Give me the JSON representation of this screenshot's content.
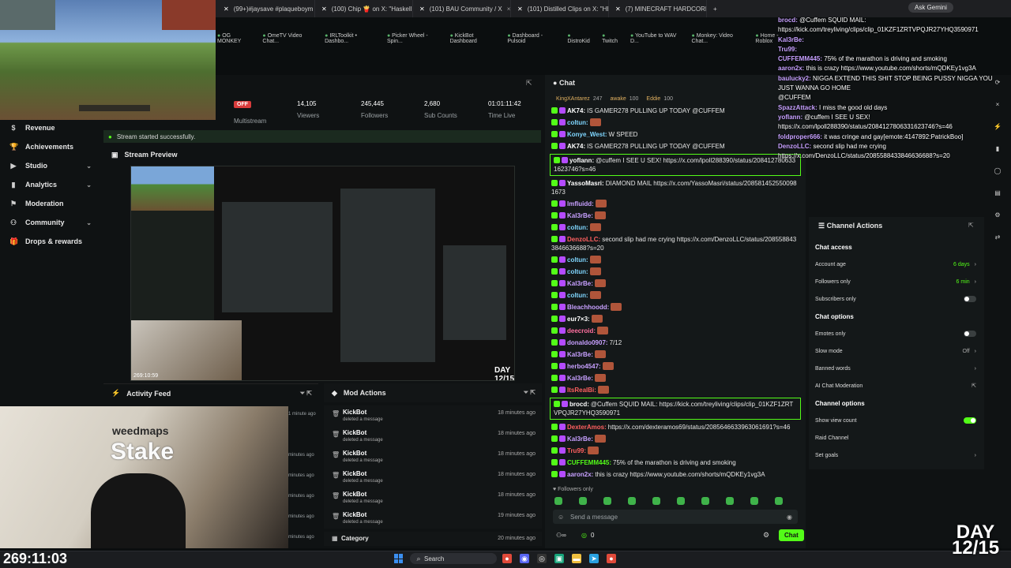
{
  "browser": {
    "tabs": [
      {
        "label": "(99+)#jaysave #plaqueboym"
      },
      {
        "label": "(100) Chip 🍟 on X: \"Haskell, C"
      },
      {
        "label": "(101) BAU Community / X"
      },
      {
        "label": "(101) Distilled Clips on X: \"HE T"
      },
      {
        "label": "(7) MINECRAFT HARDCORE AL"
      }
    ],
    "ask_gemini": "Ask Gemini",
    "bookmarks": [
      "OG MONKEY",
      "OmeTV Video Chat...",
      "IRLToolkit • Dashbo...",
      "Picker Wheel - Spin...",
      "KickBot Dashboard",
      "Dashboard - Pulsoid",
      "DistroKid",
      "Twitch",
      "YouTube to WAV D...",
      "Monkey: Video Chat...",
      "Home - Roblox"
    ]
  },
  "stats": {
    "offline_badge": "OFF",
    "multistream_label": "Multistream",
    "viewers_value": "14,105",
    "viewers_label": "Viewers",
    "followers_value": "245,445",
    "followers_label": "Followers",
    "subs_value": "2,680",
    "subs_label": "Sub Counts",
    "time_value": "01:01:11:42",
    "time_label": "Time Live"
  },
  "toast": "Stream started successfully.",
  "sidebar": {
    "items": [
      {
        "label": "Revenue",
        "chevron": false
      },
      {
        "label": "Achievements",
        "chevron": false
      },
      {
        "label": "Studio",
        "chevron": true
      },
      {
        "label": "Analytics",
        "chevron": true
      },
      {
        "label": "Moderation",
        "chevron": false
      },
      {
        "label": "Community",
        "chevron": true
      },
      {
        "label": "Drops & rewards",
        "chevron": false
      }
    ]
  },
  "stream_preview": {
    "title": "Stream Preview",
    "day_label": "DAY 12/15",
    "timer": "269:10:59"
  },
  "activity_feed": {
    "title": "Activity Feed",
    "times": [
      "1 minute ago",
      "",
      "minutes ago",
      "minutes ago",
      "minutes ago",
      "minutes ago",
      "minutes ago"
    ]
  },
  "mod_actions": {
    "title": "Mod Actions",
    "rows": [
      {
        "name": "KickBot",
        "desc": "deleted a message",
        "time": "18 minutes ago"
      },
      {
        "name": "KickBot",
        "desc": "deleted a message",
        "time": "18 minutes ago"
      },
      {
        "name": "KickBot",
        "desc": "deleted a message",
        "time": "18 minutes ago"
      },
      {
        "name": "KickBot",
        "desc": "deleted a message",
        "time": "18 minutes ago"
      },
      {
        "name": "KickBot",
        "desc": "deleted a message",
        "time": "18 minutes ago"
      },
      {
        "name": "KickBot",
        "desc": "deleted a message",
        "time": "19 minutes ago"
      }
    ],
    "footer_label": "Category",
    "footer_time": "20 minutes ago"
  },
  "chat": {
    "title": "Chat",
    "pinned": [
      {
        "user": "KingXAntarez",
        "value": "247"
      },
      {
        "user": "awake",
        "value": "100"
      },
      {
        "user": "Eddie",
        "value": "100"
      }
    ],
    "messages": [
      {
        "user": "AK74:",
        "text": "IS GAMER278 PULLING UP TODAY @CUFFEM",
        "color": "#ffffff",
        "hl": false
      },
      {
        "user": "coltun:",
        "text": "",
        "color": "#7fd6ff",
        "hl": false
      },
      {
        "user": "Konye_West:",
        "text": "W SPEED",
        "color": "#7fd6ff",
        "hl": false
      },
      {
        "user": "AK74:",
        "text": "IS GAMER278 PULLING UP TODAY @CUFFEM",
        "color": "#ffffff",
        "hl": false
      },
      {
        "user": "yoflann:",
        "text": "@cuffem I SEE U SEX! https://x.com/lpoll288390/status/2084127806331623746?s=46",
        "color": "#ffffff",
        "hl": true
      },
      {
        "user": "YassoMasri:",
        "text": "DIAMOND MAIL https://x.com/YassoMasri/status/2085814525500981673",
        "color": "#ffffff",
        "hl": false
      },
      {
        "user": "lmfluidd:",
        "text": "",
        "color": "#c7a0ff",
        "hl": false
      },
      {
        "user": "Kal3rBe:",
        "text": "",
        "color": "#c7a0ff",
        "hl": false
      },
      {
        "user": "coltun:",
        "text": "",
        "color": "#7fd6ff",
        "hl": false
      },
      {
        "user": "DenzoLLC:",
        "text": "second slip had me crying https://x.com/DenzoLLC/status/2085588433846636688?s=20",
        "color": "#ff6060",
        "hl": false
      },
      {
        "user": "coltun:",
        "text": "",
        "color": "#7fd6ff",
        "hl": false
      },
      {
        "user": "coltun:",
        "text": "",
        "color": "#7fd6ff",
        "hl": false
      },
      {
        "user": "Kal3rBe:",
        "text": "",
        "color": "#c7a0ff",
        "hl": false
      },
      {
        "user": "coltun:",
        "text": "",
        "color": "#7fd6ff",
        "hl": false
      },
      {
        "user": "Bleachhoodd:",
        "text": "",
        "color": "#c7a0ff",
        "hl": false
      },
      {
        "user": "eur7×3:",
        "text": "",
        "color": "#ffffff",
        "hl": false
      },
      {
        "user": "deecroid:",
        "text": "",
        "color": "#ff70a0",
        "hl": false
      },
      {
        "user": "donaldo0907:",
        "text": "7/12",
        "color": "#c7a0ff",
        "hl": false
      },
      {
        "user": "Kal3rBe:",
        "text": "",
        "color": "#c7a0ff",
        "hl": false
      },
      {
        "user": "herbo4547:",
        "text": "",
        "color": "#c7a0ff",
        "hl": false
      },
      {
        "user": "Kal3rBe:",
        "text": "",
        "color": "#c7a0ff",
        "hl": false
      },
      {
        "user": "ItsRealBi:",
        "text": "",
        "color": "#ff6060",
        "hl": false
      },
      {
        "user": "brocd:",
        "text": "@Cuffem SQUID MAIL: https://kick.com/treyliving/clips/clip_01KZF1ZRTVPQJR27YHQ3590971",
        "color": "#ffffff",
        "hl": true
      },
      {
        "user": "DexterAmos:",
        "text": "https://x.com/dexteramos69/status/2085646633963061691?s=46",
        "color": "#ff6060",
        "hl": false
      },
      {
        "user": "Kal3rBe:",
        "text": "",
        "color": "#c7a0ff",
        "hl": false
      },
      {
        "user": "Tru99:",
        "text": "",
        "color": "#ff6060",
        "hl": false
      },
      {
        "user": "CUFFEMM445:",
        "text": "75% of the marathon is driving and smoking",
        "color": "#53fc18",
        "hl": false
      },
      {
        "user": "aaron2x:",
        "text": "this is crazy https://www.youtube.com/shorts/mQDKEy1vg3A",
        "color": "#c7a0ff",
        "hl": false
      }
    ],
    "followers_only": "Followers only",
    "input_placeholder": "Send a message",
    "count": "0",
    "send_label": "Chat"
  },
  "channel_actions": {
    "title": "Channel Actions",
    "sections": [
      {
        "heading": "Chat access",
        "rows": [
          {
            "label": "Account age",
            "value": "6 days",
            "kind": "chev"
          },
          {
            "label": "Followers only",
            "value": "6 min",
            "kind": "chev"
          },
          {
            "label": "Subscribers only",
            "value": "",
            "kind": "toggle-off"
          }
        ]
      },
      {
        "heading": "Chat options",
        "rows": [
          {
            "label": "Emotes only",
            "value": "",
            "kind": "toggle-off"
          },
          {
            "label": "Slow mode",
            "value": "Off",
            "kind": "chev-off"
          },
          {
            "label": "Banned words",
            "value": "",
            "kind": "chev"
          },
          {
            "label": "AI Chat Moderation",
            "value": "",
            "kind": "ext"
          }
        ]
      },
      {
        "heading": "Channel options",
        "rows": [
          {
            "label": "Show view count",
            "value": "",
            "kind": "toggle-on"
          },
          {
            "label": "Raid Channel",
            "value": "",
            "kind": "none"
          },
          {
            "label": "Set goals",
            "value": "",
            "kind": "chev"
          }
        ]
      }
    ]
  },
  "overlay_chat": [
    {
      "user": "brocd:",
      "text": "@Cuffem SQUID MAIL:"
    },
    {
      "user": "",
      "text": "https://kick.com/treyliving/clips/clip_01KZF1ZRTVPQJR27YHQ3590971"
    },
    {
      "user": "Kal3rBe:",
      "text": ""
    },
    {
      "user": "Tru99:",
      "text": ""
    },
    {
      "user": "CUFFEMM445:",
      "text": "75% of the marathon is driving and smoking"
    },
    {
      "user": "aaron2x:",
      "text": "this is crazy https://www.youtube.com/shorts/mQDKEy1vg3A"
    },
    {
      "user": "baulucky2:",
      "text": "NIGGA EXTEND THIS SHIT STOP BEING PUSSY NIGGA YOU JUST WANNA GO HOME"
    },
    {
      "user": "",
      "text": "@CUFFEM"
    },
    {
      "user": "SpazzAttack:",
      "text": "I miss the good old days"
    },
    {
      "user": "yoflann:",
      "text": "@cuffem I SEE U SEX!"
    },
    {
      "user": "",
      "text": "https://x.com/lpoll288390/status/2084127806331623746?s=46"
    },
    {
      "user": "foldproper666:",
      "text": "it was cringe and gay[emote:4147892:PatrickBoo]"
    },
    {
      "user": "DenzoLLC:",
      "text": "second slip had me crying"
    },
    {
      "user": "",
      "text": "https://x.com/DenzoLLC/status/2085588433846636688?s=20"
    }
  ],
  "facecam": {
    "brand": "weedmaps",
    "stake": "Stake",
    "timer": "269:11:03",
    "day_top": "DAY",
    "day_bottom": "12/15"
  },
  "taskbar": {
    "search_placeholder": "Search"
  },
  "colors": {
    "accent": "#53fc18",
    "danger": "#d83c3c",
    "panel": "#141819",
    "background": "#0f1213"
  }
}
